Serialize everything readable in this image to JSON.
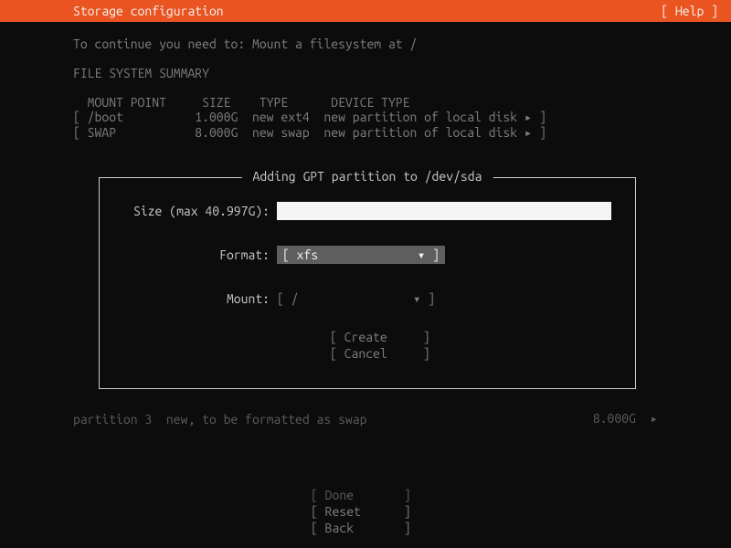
{
  "header": {
    "title": "Storage configuration",
    "help": "[ Help ]"
  },
  "hint": "To continue you need to: Mount a filesystem at /",
  "section_title": "FILE SYSTEM SUMMARY",
  "fs_header": "  MOUNT POINT     SIZE    TYPE      DEVICE TYPE",
  "fs_rows": {
    "r0": "[ /boot          1.000G  new ext4  new partition of local disk ▸ ]",
    "r1": "[ SWAP           8.000G  new swap  new partition of local disk ▸ ]"
  },
  "dialog": {
    "title": " Adding GPT partition to /dev/sda ",
    "size_label": "Size (max 40.997G):",
    "size_value": "",
    "format_label": "Format:",
    "format_value_open": "[ xfs",
    "format_value_close": "▾ ]",
    "mount_label": "Mount:",
    "mount_value": "[ /                ▾ ]",
    "create": "[ Create     ]",
    "cancel": "[ Cancel     ]"
  },
  "partition_info": {
    "left": "partition 3  new, to be formatted as swap",
    "right": "8.000G  ▸"
  },
  "bottom": {
    "done": "[ Done       ]",
    "reset": "[ Reset      ]",
    "back": "[ Back       ]"
  }
}
